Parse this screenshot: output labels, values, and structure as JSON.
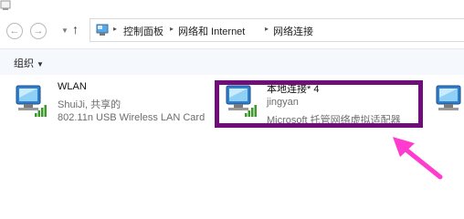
{
  "nav": {
    "back_glyph": "←",
    "forward_glyph": "→",
    "dropdown_glyph": "▼",
    "up_glyph": "↑",
    "breadcrumb": [
      "控制面板",
      "网络和 Internet",
      "网络连接"
    ],
    "separator": "▸"
  },
  "toolbar": {
    "organize_label": "组织",
    "organize_arrow": "▼"
  },
  "connections": [
    {
      "name": "WLAN",
      "status": "ShuiJi, 共享的",
      "adapter": "802.11n USB Wireless LAN Card"
    },
    {
      "name": "本地连接* 4",
      "status": "jingyan",
      "adapter": "Microsoft 托管网络虚拟适配器"
    }
  ],
  "colors": {
    "highlight": "#6f0e78",
    "arrow": "#ff3ccf",
    "signal": "#3a9a2a"
  },
  "icons": [
    "network-adapter-icon",
    "signal-bars-icon",
    "back-arrow-icon",
    "forward-arrow-icon",
    "up-arrow-icon"
  ]
}
